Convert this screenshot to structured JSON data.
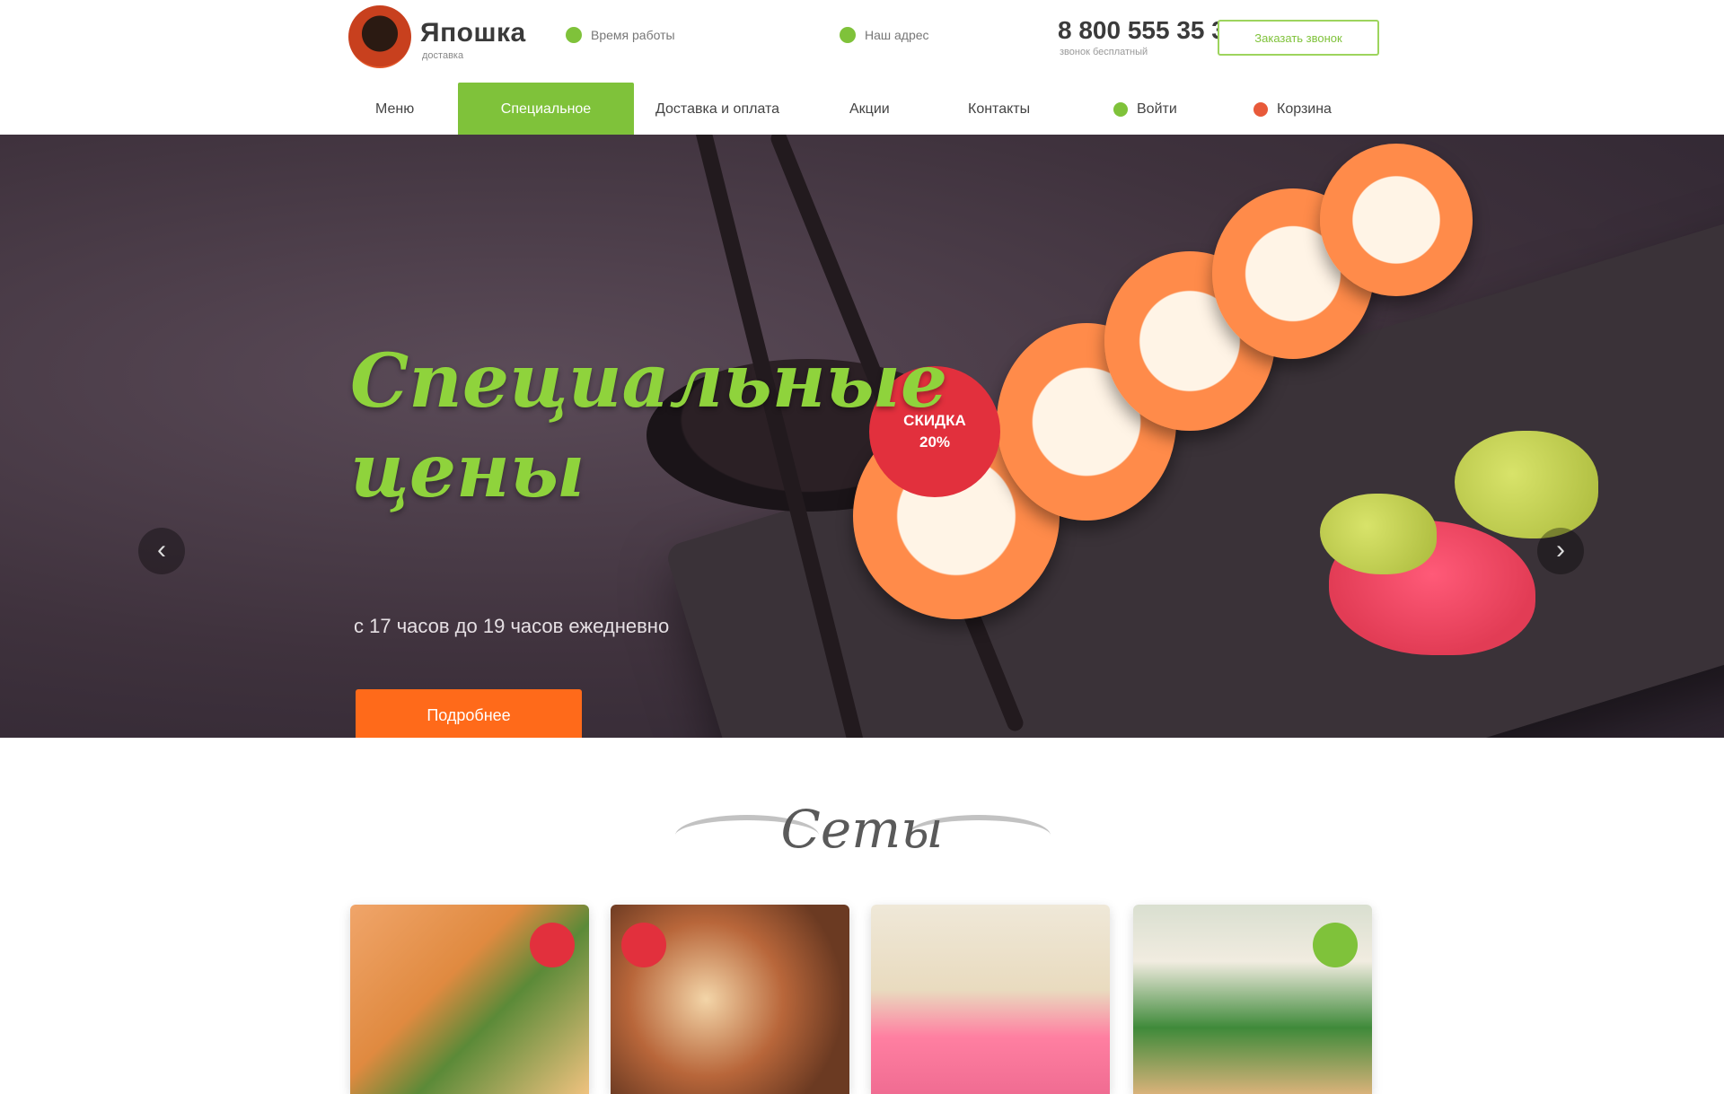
{
  "header": {
    "brand": "Япошка",
    "brand_sub": "доставка",
    "info_left": "Время работы",
    "info_right": "Наш адрес",
    "phone": "8 800 555 35 35",
    "phone_sub": "звонок бесплатный",
    "cta": "Заказать звонок"
  },
  "nav": {
    "items": [
      "Меню",
      "Специальное",
      "Доставка и оплата",
      "Акции",
      "Контакты",
      "Войти",
      "Корзина"
    ]
  },
  "hero": {
    "title_line1": "Специальные",
    "title_line2": "цены",
    "subtitle": "с 17 часов до 19 часов ежедневно",
    "button": "Подробнее",
    "badge_line1": "СКИДКА",
    "badge_line2": "20%",
    "prev": "‹",
    "next": "›"
  },
  "section": {
    "title": "Сеты"
  },
  "colors": {
    "accent_green": "#7fc23a",
    "accent_orange": "#ff6a1a",
    "badge_red": "#e2303d"
  },
  "icons": [
    "phone-icon",
    "location-icon",
    "user-icon",
    "cart-icon",
    "arrow-left-icon",
    "arrow-right-icon"
  ]
}
